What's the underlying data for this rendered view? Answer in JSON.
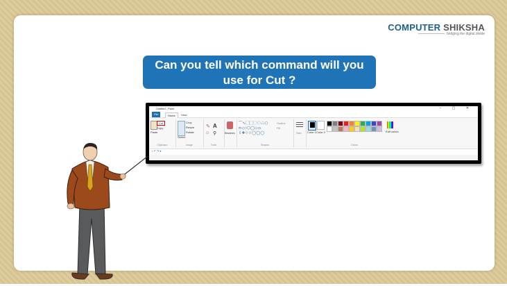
{
  "logo": {
    "computer": "COMPUTER",
    "shiksha": "SHIKSHA",
    "tagline": "bridging the digital divide"
  },
  "question": {
    "line1": "Can you tell which command will you",
    "line2": "use for Cut ?"
  },
  "paint": {
    "title": "Untitled - Paint",
    "window_controls": "− ▢ ✕",
    "tabs": [
      "File",
      "Home",
      "View"
    ],
    "clipboard": {
      "paste": "Paste",
      "cut": "Cut",
      "copy": "Copy",
      "group": "Clipboard"
    },
    "image": {
      "select": "Select",
      "crop": "Crop",
      "resize": "Resize",
      "rotate": "Rotate",
      "group": "Image"
    },
    "tools": {
      "group": "Tools"
    },
    "brushes": {
      "label": "Brushes"
    },
    "shapes": {
      "outline": "Outline",
      "fill": "Fill",
      "group": "Shapes"
    },
    "size": {
      "label": "Size"
    },
    "colors": {
      "color1": "Color 1",
      "color2": "Color 2",
      "group": "Colors",
      "edit": "Edit colors",
      "palette": [
        "#000000",
        "#7f7f7f",
        "#880015",
        "#ed1c24",
        "#ff7f27",
        "#fff200",
        "#22b14c",
        "#00a2e8",
        "#3f48cc",
        "#a349a4",
        "#ffffff",
        "#c3c3c3",
        "#b97a57",
        "#ffaec9",
        "#ffc90e",
        "#efe4b0",
        "#b5e61d",
        "#99d9ea",
        "#7092be",
        "#c8bfe7"
      ]
    }
  }
}
